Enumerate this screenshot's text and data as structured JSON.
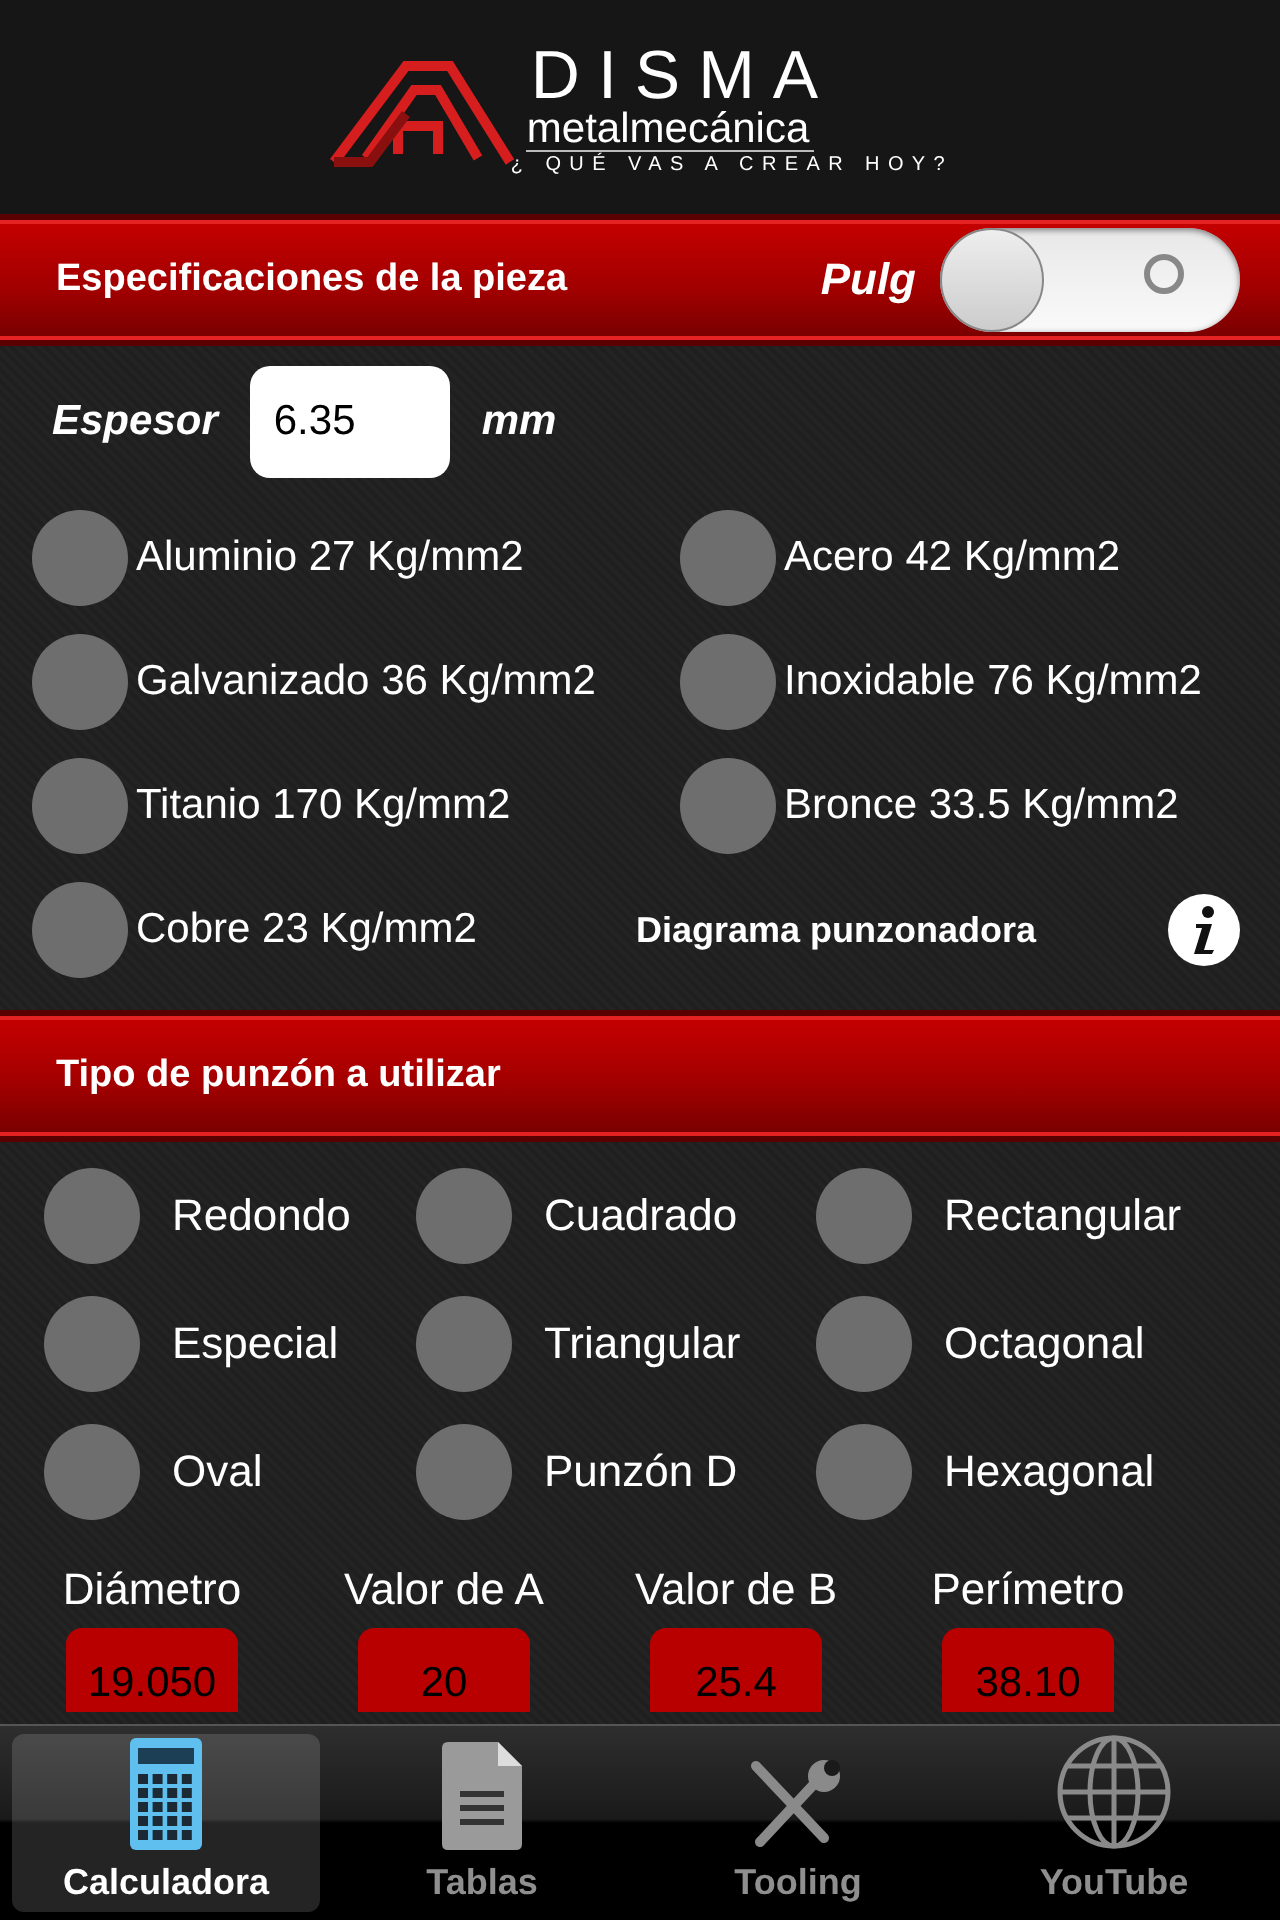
{
  "header": {
    "brand": "DISMA",
    "subtitle": "metalmecánica",
    "tagline": "¿ QUÉ VAS A CREAR HOY?"
  },
  "specs": {
    "title": "Especificaciones de la pieza",
    "unit_toggle": {
      "label": "Pulg",
      "on": false
    },
    "thickness": {
      "label": "Espesor",
      "value": "6.35",
      "unit": "mm"
    },
    "materials": [
      {
        "label": "Aluminio 27 Kg/mm2",
        "selected": false
      },
      {
        "label": "Acero 42 Kg/mm2",
        "selected": false
      },
      {
        "label": "Galvanizado 36 Kg/mm2",
        "selected": false
      },
      {
        "label": "Inoxidable 76 Kg/mm2",
        "selected": false
      },
      {
        "label": "Titanio 170 Kg/mm2",
        "selected": false
      },
      {
        "label": "Bronce 33.5 Kg/mm2",
        "selected": false
      },
      {
        "label": "Cobre 23 Kg/mm2",
        "selected": false
      }
    ],
    "diagram_link": "Diagrama punzonadora"
  },
  "punch": {
    "title": "Tipo de punzón a utilizar",
    "types": [
      {
        "label": "Redondo",
        "selected": false
      },
      {
        "label": "Cuadrado",
        "selected": false
      },
      {
        "label": "Rectangular",
        "selected": false
      },
      {
        "label": "Especial",
        "selected": false
      },
      {
        "label": "Triangular",
        "selected": false
      },
      {
        "label": "Octagonal",
        "selected": false
      },
      {
        "label": "Oval",
        "selected": false
      },
      {
        "label": "Punzón D",
        "selected": false
      },
      {
        "label": "Hexagonal",
        "selected": false
      }
    ],
    "results": [
      {
        "label": "Diámetro",
        "value": "19.050"
      },
      {
        "label": "Valor de A",
        "value": "20"
      },
      {
        "label": "Valor de B",
        "value": "25.4"
      },
      {
        "label": "Perímetro",
        "value": "38.10"
      }
    ]
  },
  "tab_bar": [
    {
      "label": "Calculadora",
      "kind": "calculator",
      "selected": true
    },
    {
      "label": "Tablas",
      "kind": "document",
      "selected": false
    },
    {
      "label": "Tooling",
      "kind": "tools",
      "selected": false
    },
    {
      "label": "YouTube",
      "kind": "globe",
      "selected": false
    }
  ]
}
